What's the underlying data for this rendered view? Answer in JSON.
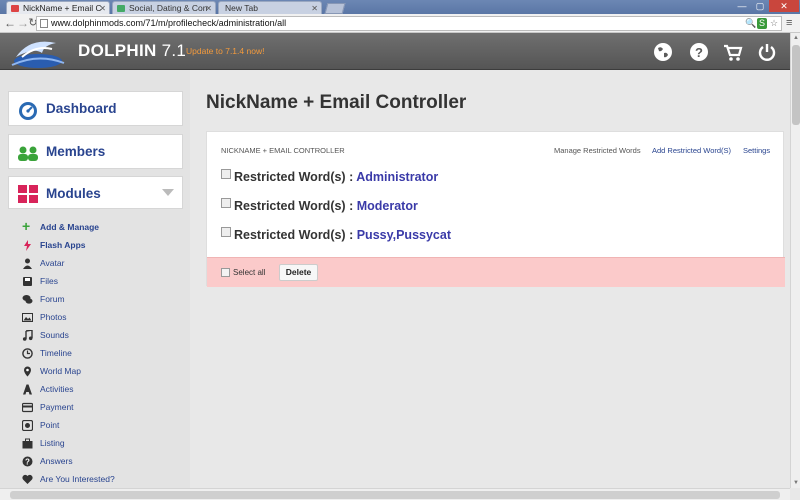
{
  "browser": {
    "tabs": [
      {
        "label": "NickName + Email C",
        "active": true
      },
      {
        "label": "Social, Dating & Con",
        "active": false
      },
      {
        "label": "New Tab",
        "active": false
      }
    ],
    "url": "www.dolphinmods.com/71/m/profilecheck/administration/all"
  },
  "header": {
    "brand": "DOLPHIN",
    "version": "7.1",
    "update_notice": "Update to 7.1.4 now!",
    "accent_color": "#f39a3c"
  },
  "sidebar": {
    "cards": [
      {
        "label": "Dashboard",
        "icon": "dashboard-gauge-icon"
      },
      {
        "label": "Members",
        "icon": "members-icon"
      },
      {
        "label": "Modules",
        "icon": "modules-grid-icon"
      }
    ],
    "module_items": [
      {
        "label": "Add & Manage",
        "icon": "plus-icon",
        "bold": true
      },
      {
        "label": "Flash Apps",
        "icon": "flash-icon",
        "bold": true
      },
      {
        "label": "Avatar",
        "icon": "avatar-icon"
      },
      {
        "label": "Files",
        "icon": "files-icon"
      },
      {
        "label": "Forum",
        "icon": "forum-icon"
      },
      {
        "label": "Photos",
        "icon": "photos-icon"
      },
      {
        "label": "Sounds",
        "icon": "sounds-icon"
      },
      {
        "label": "Timeline",
        "icon": "timeline-icon"
      },
      {
        "label": "World Map",
        "icon": "world-map-icon"
      },
      {
        "label": "Activities",
        "icon": "activities-icon"
      },
      {
        "label": "Payment",
        "icon": "payment-icon"
      },
      {
        "label": "Point",
        "icon": "point-icon"
      },
      {
        "label": "Listing",
        "icon": "listing-icon"
      },
      {
        "label": "Answers",
        "icon": "answers-icon"
      },
      {
        "label": "Are You Interested?",
        "icon": "heart-icon"
      }
    ]
  },
  "main": {
    "title": "NickName + Email Controller",
    "panel": {
      "heading": "NICKNAME + EMAIL CONTROLLER",
      "links": [
        "Manage Restricted Words",
        "Add Restricted Word(S)",
        "Settings"
      ],
      "rows": [
        {
          "label": "Restricted Word(s) :",
          "value": "Administrator"
        },
        {
          "label": "Restricted Word(s) :",
          "value": "Moderator"
        },
        {
          "label": "Restricted Word(s) :",
          "value": "Pussy,Pussycat"
        }
      ],
      "select_all": "Select all",
      "delete": "Delete"
    }
  }
}
